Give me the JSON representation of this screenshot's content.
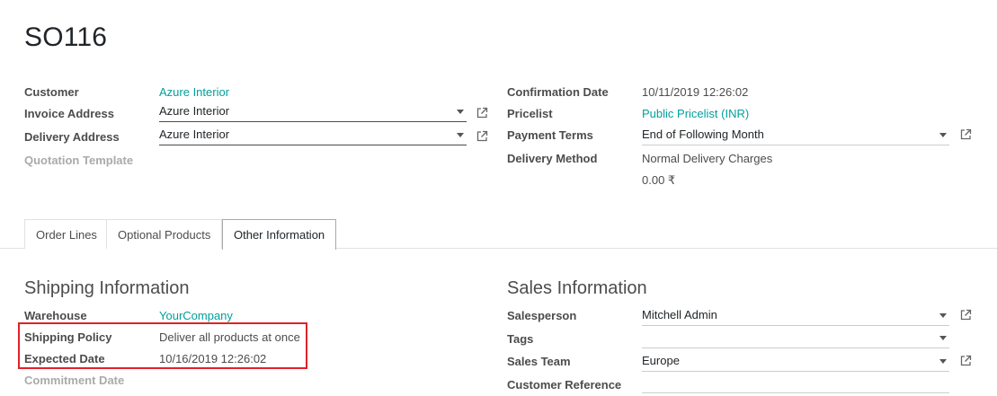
{
  "page": {
    "title": "SO116"
  },
  "left": {
    "customer_label": "Customer",
    "customer_value": "Azure Interior",
    "invoice_label": "Invoice Address",
    "invoice_value": "Azure Interior",
    "delivery_label": "Delivery Address",
    "delivery_value": "Azure Interior",
    "template_label": "Quotation Template"
  },
  "right": {
    "confirmation_label": "Confirmation Date",
    "confirmation_value": "10/11/2019 12:26:02",
    "pricelist_label": "Pricelist",
    "pricelist_value": "Public Pricelist (INR)",
    "payment_label": "Payment Terms",
    "payment_value": "End of Following Month",
    "delivery_method_label": "Delivery Method",
    "delivery_method_value": "Normal Delivery Charges",
    "delivery_amount": "0.00 ₹"
  },
  "tabs": [
    {
      "label": "Order Lines"
    },
    {
      "label": "Optional Products"
    },
    {
      "label": "Other Information",
      "active": true
    }
  ],
  "shipping": {
    "title": "Shipping Information",
    "warehouse_label": "Warehouse",
    "warehouse_value": "YourCompany",
    "policy_label": "Shipping Policy",
    "policy_value": "Deliver all products at once",
    "expected_label": "Expected Date",
    "expected_value": "10/16/2019 12:26:02",
    "commitment_label": "Commitment Date"
  },
  "sales": {
    "title": "Sales Information",
    "salesperson_label": "Salesperson",
    "salesperson_value": "Mitchell Admin",
    "tags_label": "Tags",
    "tags_value": "",
    "team_label": "Sales Team",
    "team_value": "Europe",
    "reference_label": "Customer Reference",
    "reference_value": ""
  },
  "colors": {
    "link": "#00a09d",
    "highlight": "#e0212b"
  },
  "icons": {
    "external": "external-link-icon",
    "dropdown": "caret-down-icon"
  }
}
